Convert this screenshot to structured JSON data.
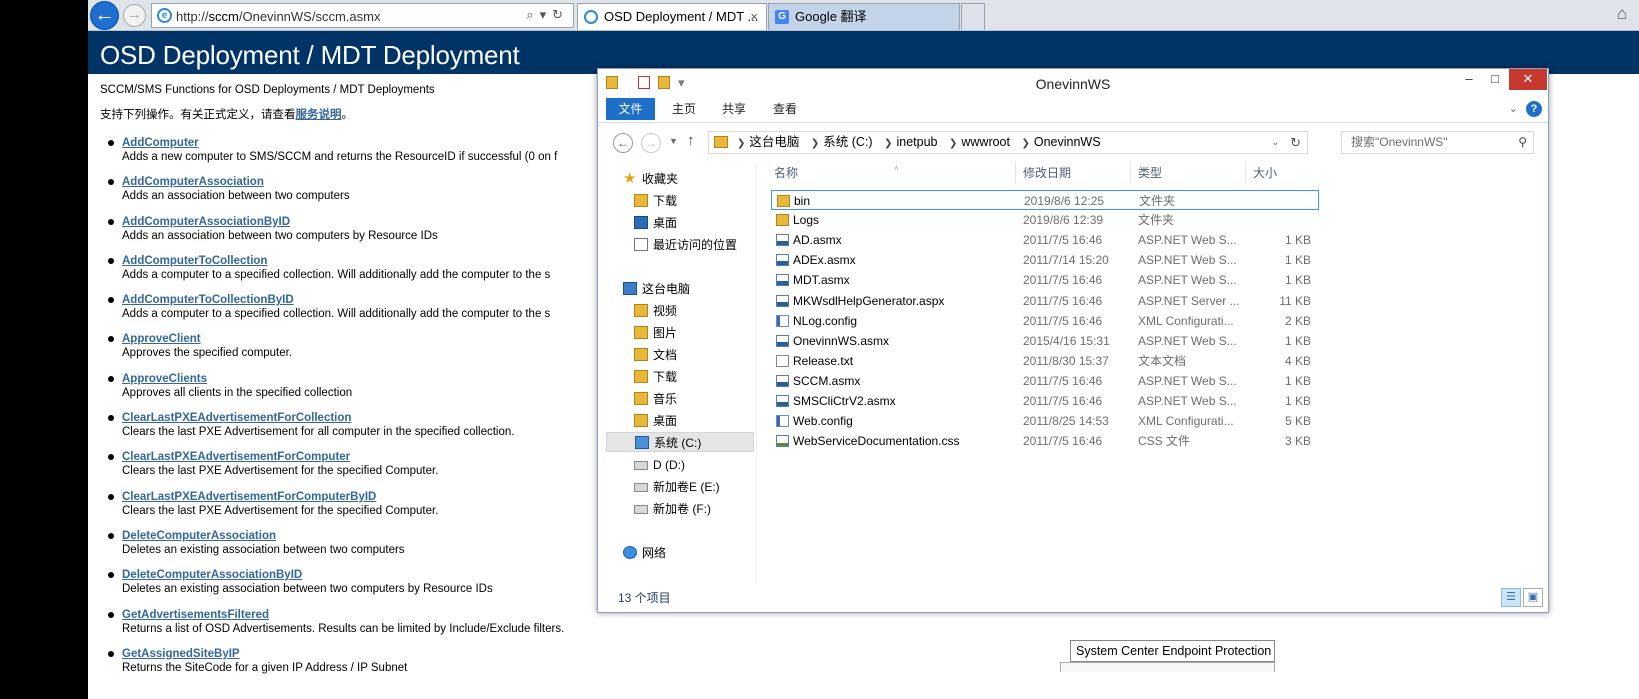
{
  "browser": {
    "url_prefix": "http://",
    "url_host": "sccm",
    "url_path": "/OnevinnWS/sccm.asmx",
    "tabs": [
      {
        "label": "OSD Deployment / MDT ..."
      },
      {
        "label": "Google 翻译"
      }
    ]
  },
  "page": {
    "title": "OSD Deployment / MDT Deployment",
    "subtitle": "SCCM/SMS Functions for OSD Deployments / MDT Deployments",
    "intro_text": "支持下列操作。有关正式定义，请查看",
    "intro_link": "服务说明",
    "intro_end": "。",
    "operations": [
      {
        "name": "AddComputer",
        "desc": "Adds a new computer to SMS/SCCM and returns the ResourceID if successful (0 on f"
      },
      {
        "name": "AddComputerAssociation",
        "desc": "Adds an association between two computers"
      },
      {
        "name": "AddComputerAssociationByID",
        "desc": "Adds an association between two computers by Resource IDs"
      },
      {
        "name": "AddComputerToCollection",
        "desc": "Adds a computer to a specified collection. Will additionally add the computer to the s"
      },
      {
        "name": "AddComputerToCollectionByID",
        "desc": "Adds a computer to a specified collection. Will additionally add the computer to the s"
      },
      {
        "name": "ApproveClient",
        "desc": "Approves the specified computer."
      },
      {
        "name": "ApproveClients",
        "desc": "Approves all clients in the specified collection"
      },
      {
        "name": "ClearLastPXEAdvertisementForCollection",
        "desc": "Clears the last PXE Advertisement for all computer in the specified collection."
      },
      {
        "name": "ClearLastPXEAdvertisementForComputer",
        "desc": "Clears the last PXE Advertisement for the specified Computer."
      },
      {
        "name": "ClearLastPXEAdvertisementForComputerByID",
        "desc": "Clears the last PXE Advertisement for the specified Computer."
      },
      {
        "name": "DeleteComputerAssociation",
        "desc": "Deletes an existing association between two computers"
      },
      {
        "name": "DeleteComputerAssociationByID",
        "desc": "Deletes an existing association between two computers by Resource IDs"
      },
      {
        "name": "GetAdvertisementsFiltered",
        "desc": "Returns a list of OSD Advertisements. Results can be limited by Include/Exclude filters."
      },
      {
        "name": "GetAssignedSiteByIP",
        "desc": "Returns the SiteCode for a given IP Address / IP Subnet"
      }
    ],
    "popup_label": "System Center Endpoint Protection"
  },
  "explorer": {
    "title": "OnevinnWS",
    "ribbon_tabs": [
      "文件",
      "主页",
      "共享",
      "查看"
    ],
    "breadcrumb": [
      "这台电脑",
      "系统 (C:)",
      "inetpub",
      "wwwroot",
      "OnevinnWS"
    ],
    "search_placeholder": "搜索\"OnevinnWS\"",
    "sidebar": {
      "favorites": "收藏夹",
      "fav_items": [
        "下载",
        "桌面",
        "最近访问的位置"
      ],
      "this_pc": "这台电脑",
      "pc_items": [
        "视频",
        "图片",
        "文档",
        "下载",
        "音乐",
        "桌面"
      ],
      "drives": [
        "系统 (C:)",
        "D (D:)",
        "新加卷E (E:)",
        "新加卷 (F:)"
      ],
      "network": "网络"
    },
    "columns": {
      "name": "名称",
      "date": "修改日期",
      "type": "类型",
      "size": "大小"
    },
    "files": [
      {
        "name": "bin",
        "date": "2019/8/6 12:25",
        "type": "文件夹",
        "size": "",
        "icon": "folder"
      },
      {
        "name": "Logs",
        "date": "2019/8/6 12:39",
        "type": "文件夹",
        "size": "",
        "icon": "folder"
      },
      {
        "name": "AD.asmx",
        "date": "2011/7/5 16:46",
        "type": "ASP.NET Web S...",
        "size": "1 KB",
        "icon": "web"
      },
      {
        "name": "ADEx.asmx",
        "date": "2011/7/14 15:20",
        "type": "ASP.NET Web S...",
        "size": "1 KB",
        "icon": "web"
      },
      {
        "name": "MDT.asmx",
        "date": "2011/7/5 16:46",
        "type": "ASP.NET Web S...",
        "size": "1 KB",
        "icon": "web"
      },
      {
        "name": "MKWsdlHelpGenerator.aspx",
        "date": "2011/7/5 16:46",
        "type": "ASP.NET Server ...",
        "size": "11 KB",
        "icon": "web"
      },
      {
        "name": "NLog.config",
        "date": "2011/7/5 16:46",
        "type": "XML Configurati...",
        "size": "2 KB",
        "icon": "cfg"
      },
      {
        "name": "OnevinnWS.asmx",
        "date": "2015/4/16 15:31",
        "type": "ASP.NET Web S...",
        "size": "1 KB",
        "icon": "web"
      },
      {
        "name": "Release.txt",
        "date": "2011/8/30 15:37",
        "type": "文本文档",
        "size": "4 KB",
        "icon": "txt"
      },
      {
        "name": "SCCM.asmx",
        "date": "2011/7/5 16:46",
        "type": "ASP.NET Web S...",
        "size": "1 KB",
        "icon": "web"
      },
      {
        "name": "SMSCliCtrV2.asmx",
        "date": "2011/7/5 16:46",
        "type": "ASP.NET Web S...",
        "size": "1 KB",
        "icon": "web"
      },
      {
        "name": "Web.config",
        "date": "2011/8/25 14:53",
        "type": "XML Configurati...",
        "size": "5 KB",
        "icon": "cfg"
      },
      {
        "name": "WebServiceDocumentation.css",
        "date": "2011/7/5 16:46",
        "type": "CSS 文件",
        "size": "3 KB",
        "icon": "css"
      }
    ],
    "status": "13 个项目"
  },
  "colors": {
    "banner": "#003366",
    "link": "#336699",
    "accent": "#1d6fc9"
  }
}
